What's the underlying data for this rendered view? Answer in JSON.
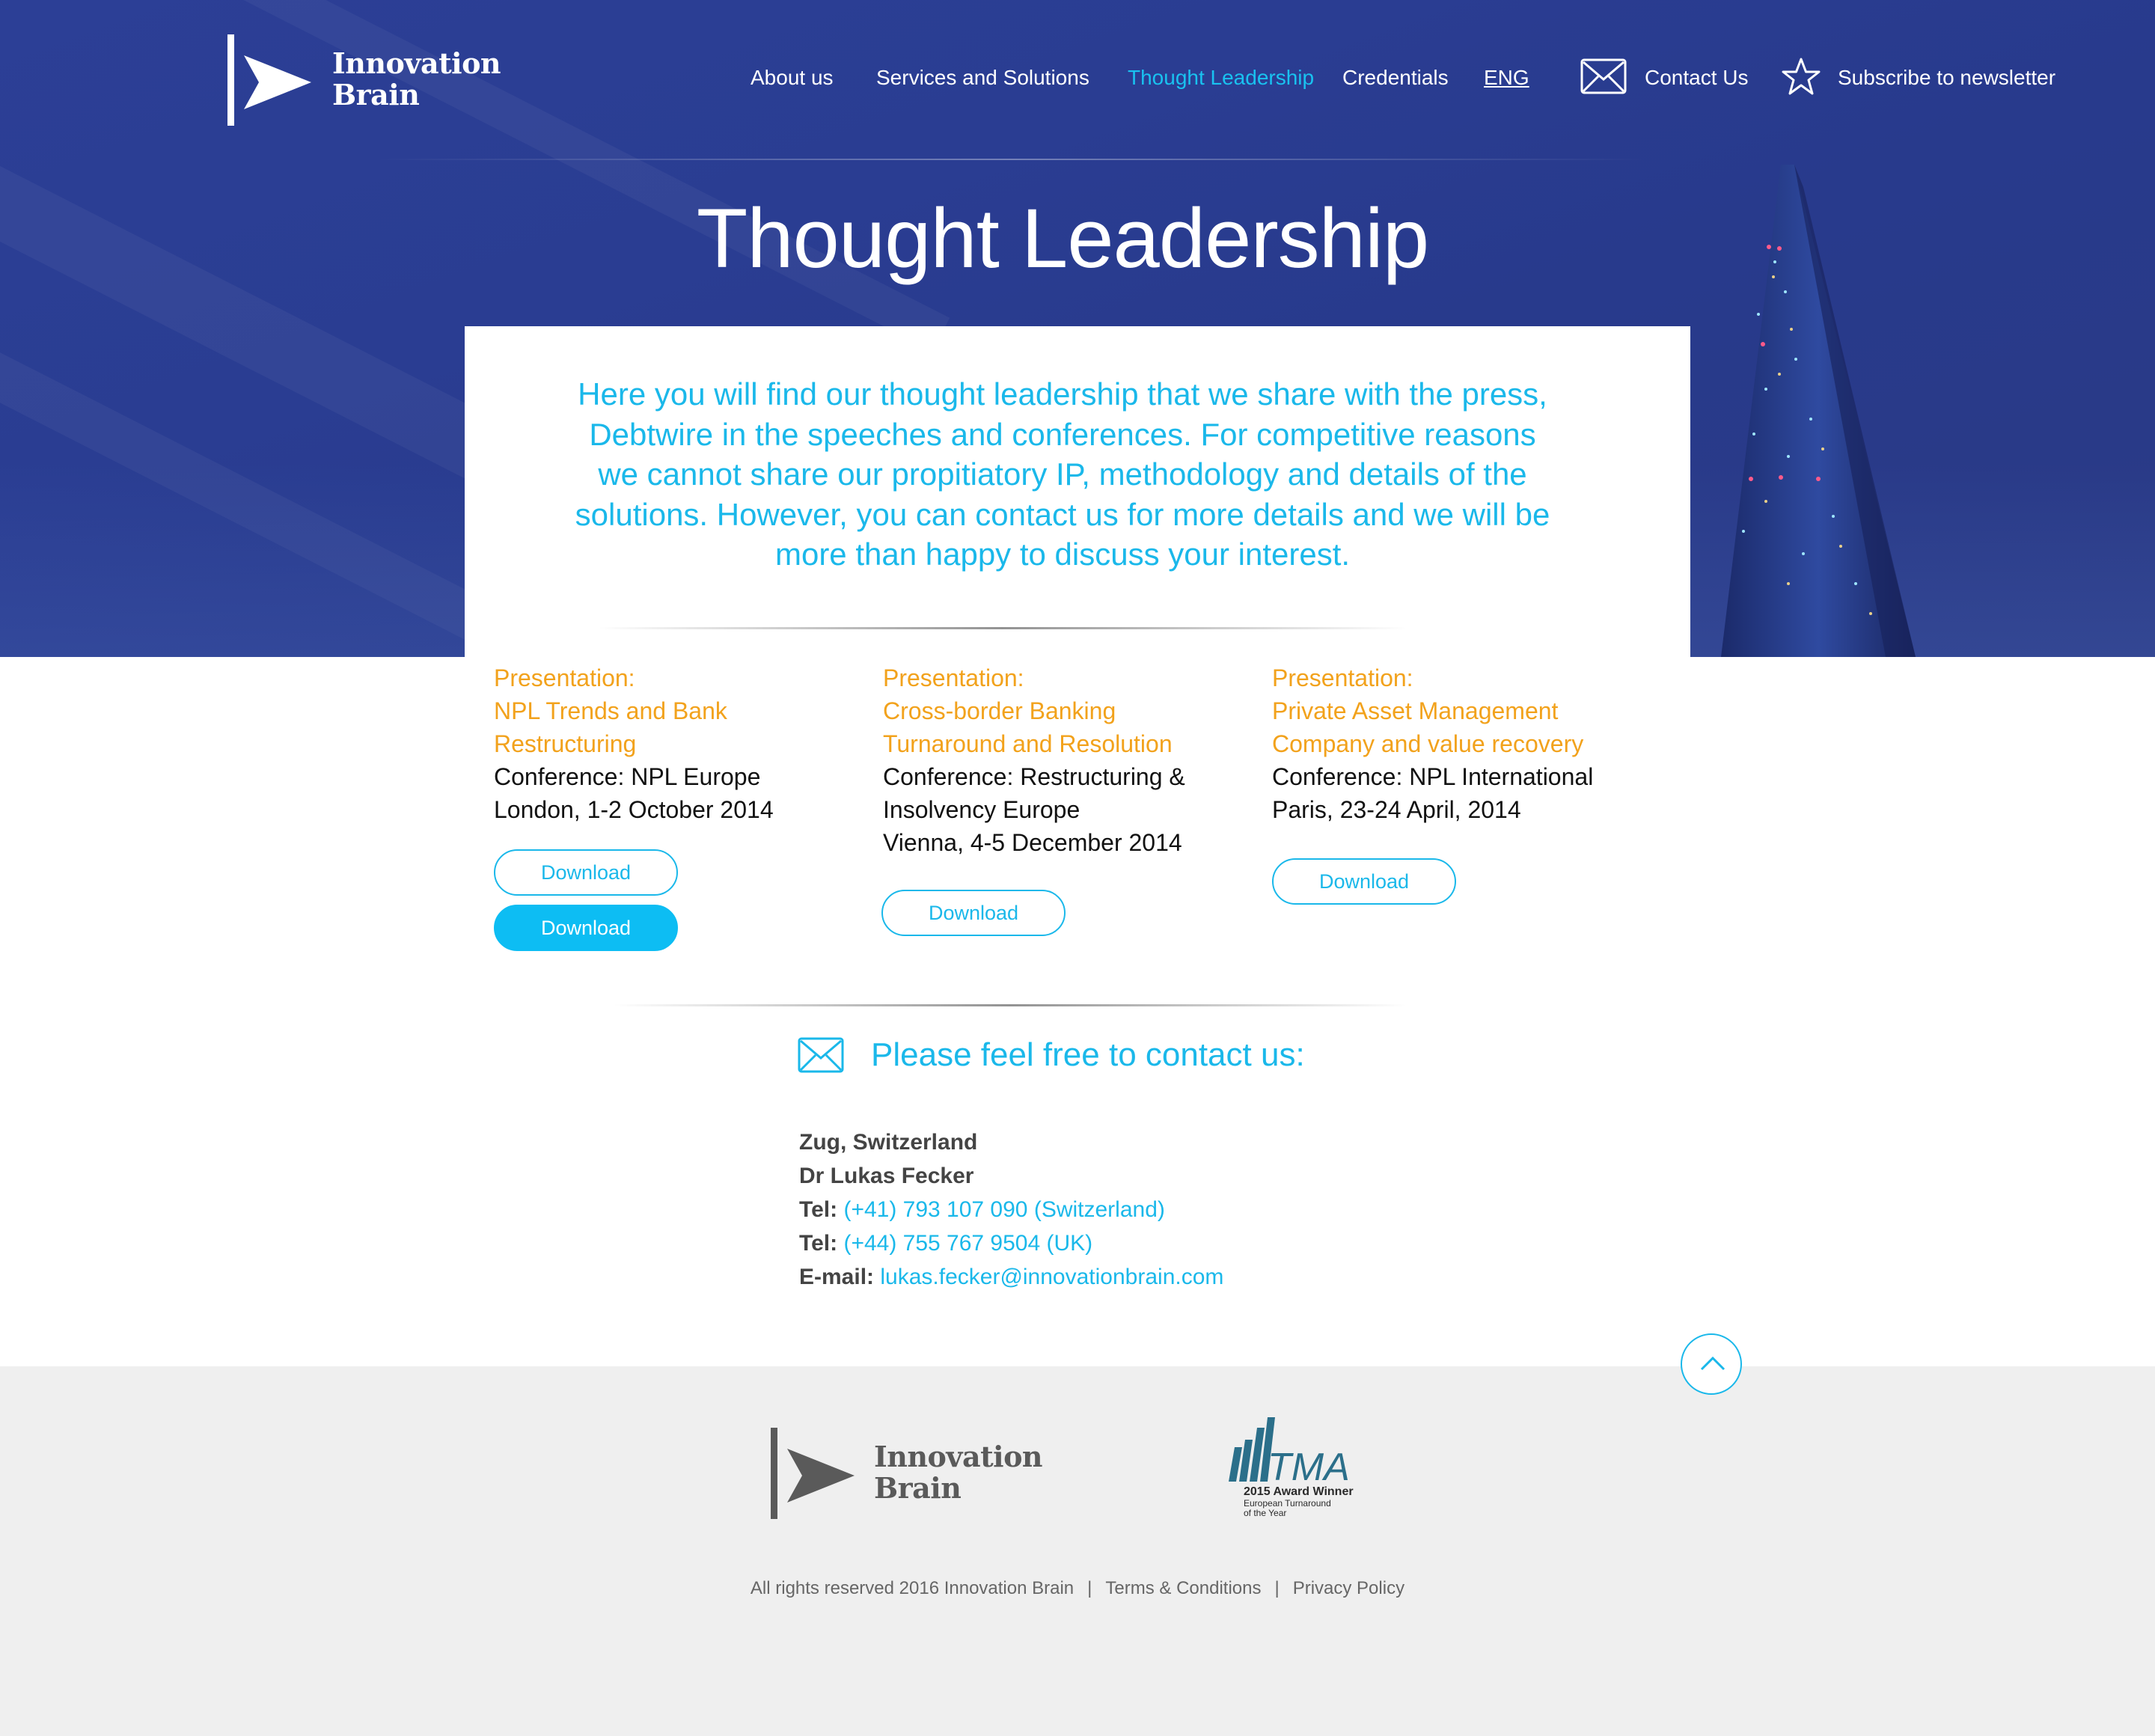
{
  "brand": {
    "line1": "Innovation",
    "line2": "Brain"
  },
  "nav": {
    "about": "About us",
    "services": "Services and Solutions",
    "thought": "Thought Leadership",
    "credentials": "Credentials",
    "lang": "ENG",
    "contact": "Contact Us",
    "subscribe": "Subscribe to newsletter"
  },
  "page": {
    "title": "Thought Leadership",
    "intro": "Here you will find our thought leadership that we share with the press, Debtwire in the speeches and conferences. For competitive reasons we cannot share our propitiatory IP, methodology and details of the solutions. However, you can contact us for more details and we will be more than happy to discuss your interest."
  },
  "presentations": [
    {
      "kicker": "Presentation:",
      "title": "NPL Trends and Bank Restructuring",
      "conference": "Conference: NPL Europe\nLondon, 1-2 October 2014",
      "buttons": [
        "Download",
        "Download"
      ]
    },
    {
      "kicker": "Presentation:",
      "title": "Cross-border Banking Turnaround and Resolution",
      "conference": "Conference: Restructuring &\nInsolvency Europe\nVienna, 4-5 December 2014",
      "buttons": [
        "Download"
      ]
    },
    {
      "kicker": "Presentation:",
      "title": "Private Asset Management Company and value recovery",
      "conference": "Conference: NPL International\nParis, 23-24 April, 2014",
      "buttons": [
        "Download"
      ]
    }
  ],
  "contact": {
    "heading": "Please feel free to contact us:",
    "location": "Zug, Switzerland",
    "name": "Dr Lukas Fecker",
    "tel_label": "Tel:",
    "tel1": "(+41) 793 107 090 (Switzerland)",
    "tel2": "(+44) 755 767 9504 (UK)",
    "email_label": "E-mail:",
    "email": "lukas.fecker@innovationbrain.com"
  },
  "footer": {
    "award_logo": "TMA",
    "award_line1": "2015 Award Winner",
    "award_line2": "European Turnaround",
    "award_line3": "of the Year",
    "copyright": "All rights reserved 2016 Innovation Brain",
    "sep": "|",
    "terms": "Terms & Conditions",
    "privacy": "Privacy Policy"
  },
  "colors": {
    "accent": "#1ab8ea",
    "orange": "#f2a21c",
    "hero": "#2b3d92",
    "footer_bg": "#efefef"
  },
  "icons": [
    "envelope-icon",
    "star-icon",
    "chevron-up-icon"
  ]
}
